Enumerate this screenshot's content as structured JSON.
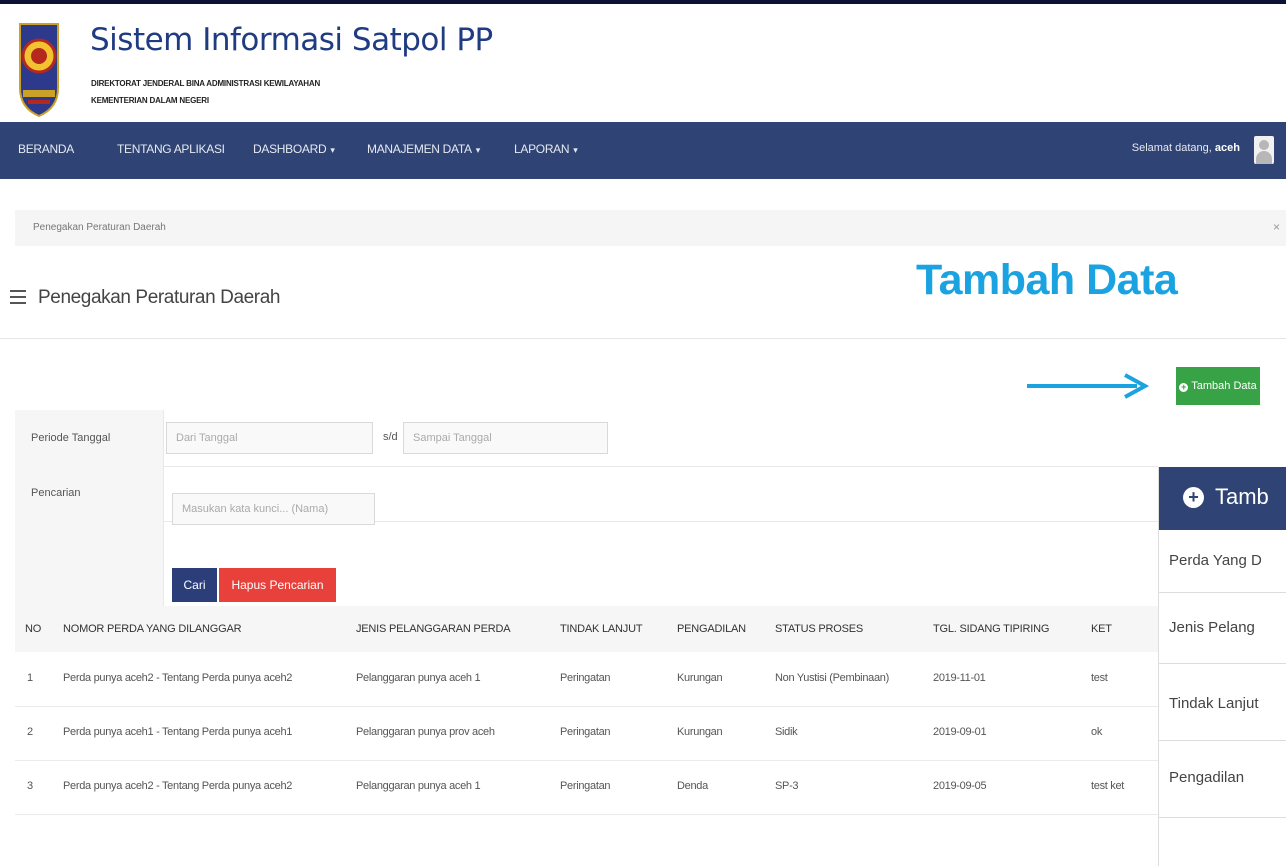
{
  "header": {
    "app_title": "Sistem Informasi Satpol PP",
    "subtitle_line1": "DIREKTORAT JENDERAL BINA ADMINISTRASI KEWILAYAHAN",
    "subtitle_line2": "KEMENTERIAN DALAM NEGERI"
  },
  "nav": {
    "items": [
      "BERANDA",
      "TENTANG APLIKASI",
      "DASHBOARD",
      "MANAJEMEN DATA",
      "LAPORAN"
    ],
    "welcome_prefix": "Selamat datang,",
    "username": "aceh"
  },
  "breadcrumb": {
    "text": "Penegakan Peraturan Daerah",
    "close": "×"
  },
  "page": {
    "title": "Penegakan Peraturan Daerah"
  },
  "annotation": {
    "title": "Tambah Data"
  },
  "add_button": {
    "label": "Tambah Data"
  },
  "filter": {
    "period_label": "Periode Tanggal",
    "from_placeholder": "Dari Tanggal",
    "separator": "s/d",
    "to_placeholder": "Sampai Tanggal",
    "search_label": "Pencarian",
    "search_placeholder": "Masukan kata kunci... (Nama)",
    "search_button": "Cari",
    "clear_button": "Hapus Pencarian"
  },
  "table": {
    "headers": [
      "NO",
      "NOMOR PERDA YANG DILANGGAR",
      "JENIS PELANGGARAN PERDA",
      "TINDAK LANJUT",
      "PENGADILAN",
      "STATUS PROSES",
      "TGL. SIDANG TIPIRING",
      "KET"
    ],
    "rows": [
      [
        "1",
        "Perda punya aceh2 - Tentang Perda punya aceh2",
        "Pelanggaran punya aceh 1",
        "Peringatan",
        "Kurungan",
        "Non Yustisi (Pembinaan)",
        "2019-11-01",
        "test"
      ],
      [
        "2",
        "Perda punya aceh1 - Tentang Perda punya aceh1",
        "Pelanggaran punya prov aceh",
        "Peringatan",
        "Kurungan",
        "Sidik",
        "2019-09-01",
        "ok"
      ],
      [
        "3",
        "Perda punya aceh2 - Tentang Perda punya aceh2",
        "Pelanggaran punya aceh 1",
        "Peringatan",
        "Denda",
        "SP-3",
        "2019-09-05",
        "test ket"
      ]
    ]
  },
  "panel": {
    "title": "Tamb",
    "fields": [
      "Perda Yang D",
      "Jenis Pelang",
      "Tindak Lanjut",
      "Pengadilan"
    ]
  },
  "colors": {
    "navbar": "#2f4374",
    "title_blue": "#1f3b82",
    "annotation_blue": "#1aa3e0",
    "add_green": "#38a346",
    "search_navy": "#2b3e7a",
    "clear_red": "#e8403a"
  }
}
